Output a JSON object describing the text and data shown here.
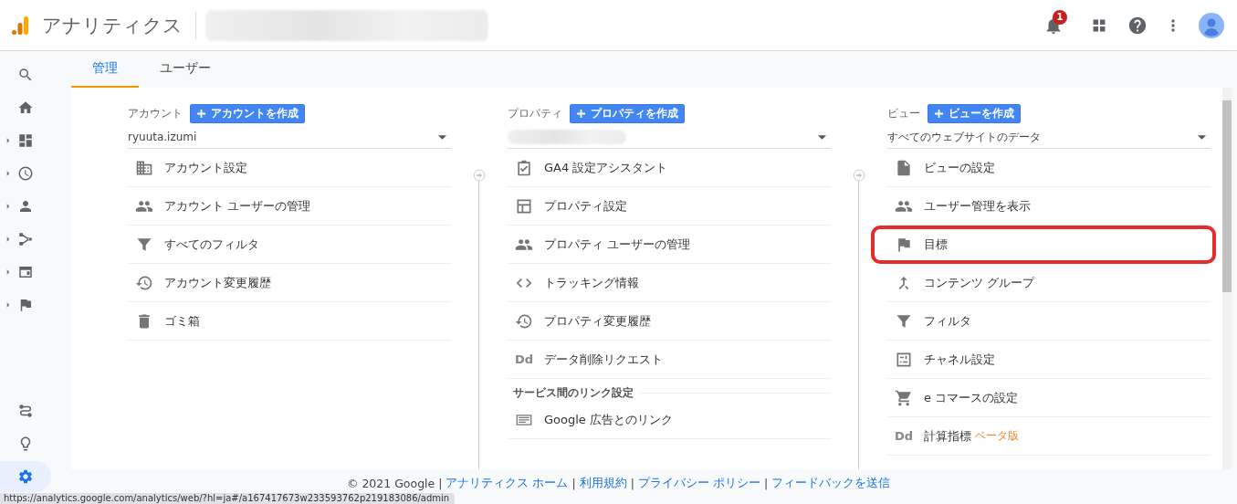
{
  "header": {
    "app_title": "アナリティクス",
    "account_redacted": true,
    "notification_count": "1"
  },
  "sidebar": {
    "items": [
      {
        "expandable": false,
        "selected": false
      },
      {
        "expandable": false,
        "selected": false
      },
      {
        "expandable": true,
        "selected": false
      },
      {
        "expandable": true,
        "selected": false
      },
      {
        "expandable": true,
        "selected": false
      },
      {
        "expandable": true,
        "selected": false
      },
      {
        "expandable": true,
        "selected": false
      },
      {
        "expandable": true,
        "selected": false
      }
    ],
    "bottom_items": [
      {
        "selected": false
      },
      {
        "selected": false
      },
      {
        "selected": true
      }
    ]
  },
  "tabs": [
    {
      "label": "管理",
      "selected": true
    },
    {
      "label": "ユーザー",
      "selected": false
    }
  ],
  "columns": [
    {
      "label": "アカウント",
      "create_button": "アカウントを作成",
      "selector": {
        "value": "ryuuta.izumi",
        "redacted": false
      },
      "items": [
        {
          "kind": "item",
          "label": "アカウント設定",
          "highlighted": false
        },
        {
          "kind": "item",
          "label": "アカウント ユーザーの管理",
          "highlighted": false
        },
        {
          "kind": "item",
          "label": "すべてのフィルタ",
          "highlighted": false
        },
        {
          "kind": "item",
          "label": "アカウント変更履歴",
          "highlighted": false
        },
        {
          "kind": "item",
          "label": "ゴミ箱",
          "highlighted": false
        }
      ]
    },
    {
      "label": "プロパティ",
      "create_button": "プロパティを作成",
      "selector": {
        "redacted": true
      },
      "items": [
        {
          "kind": "item",
          "label": "GA4 設定アシスタント",
          "highlighted": false
        },
        {
          "kind": "item",
          "label": "プロパティ設定",
          "highlighted": false
        },
        {
          "kind": "item",
          "label": "プロパティ ユーザーの管理",
          "highlighted": false
        },
        {
          "kind": "item",
          "label": "トラッキング情報",
          "highlighted": false
        },
        {
          "kind": "item",
          "label": "プロパティ変更履歴",
          "highlighted": false
        },
        {
          "kind": "item",
          "label": "データ削除リクエスト",
          "icon_text": "Dd",
          "highlighted": false
        },
        {
          "kind": "heading",
          "label": "サービス間のリンク設定"
        },
        {
          "kind": "item",
          "label": "Google 広告とのリンク",
          "highlighted": false
        }
      ]
    },
    {
      "label": "ビュー",
      "create_button": "ビューを作成",
      "selector": {
        "value": "すべてのウェブサイトのデータ",
        "redacted": false
      },
      "items": [
        {
          "kind": "item",
          "label": "ビューの設定",
          "highlighted": false
        },
        {
          "kind": "item",
          "label": "ユーザー管理を表示",
          "highlighted": false
        },
        {
          "kind": "item",
          "label": "目標",
          "highlighted": true
        },
        {
          "kind": "item",
          "label": "コンテンツ グループ",
          "highlighted": false
        },
        {
          "kind": "item",
          "label": "フィルタ",
          "highlighted": false
        },
        {
          "kind": "item",
          "label": "チャネル設定",
          "highlighted": false
        },
        {
          "kind": "item",
          "label": "e コマースの設定",
          "highlighted": false
        },
        {
          "kind": "item",
          "label": "計算指標",
          "icon_text": "Dd",
          "badge": "ベータ版",
          "highlighted": false
        }
      ]
    }
  ],
  "footer": {
    "copyright": "© 2021 Google",
    "separator": "|",
    "links": [
      "アナリティクス ホーム",
      "利用規約",
      "プライバシー ポリシー",
      "フィードバックを送信"
    ]
  },
  "status_url": "https://analytics.google.com/analytics/web/?hl=ja#/a167417673w233593762p219183086/admin"
}
